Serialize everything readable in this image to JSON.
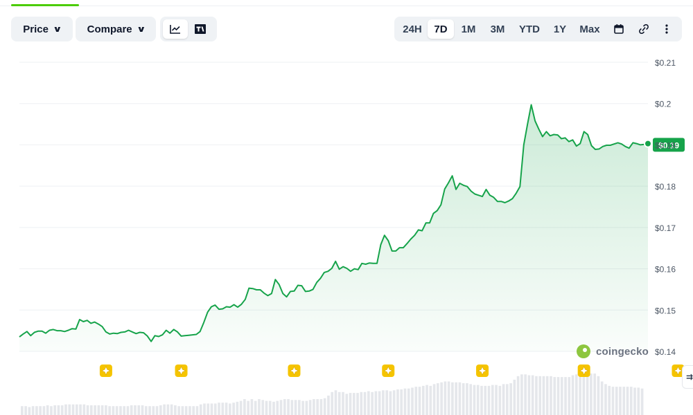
{
  "toolbar": {
    "price_label": "Price",
    "compare_label": "Compare",
    "line_chart_icon": "line-chart-icon",
    "tradingview_icon": "tradingview-icon",
    "ranges": [
      "24H",
      "7D",
      "1M",
      "3M",
      "YTD",
      "1Y",
      "Max"
    ],
    "active_range": "7D",
    "calendar_icon": "calendar-icon",
    "link_icon": "link-icon",
    "more_icon": "more-vertical-icon"
  },
  "watermark": {
    "text": "coingecko",
    "icon": "coingecko-logo-icon"
  },
  "side_tab": {
    "label": "⇉"
  },
  "colors": {
    "line": "#16a34a",
    "badge": "#16a34a",
    "marker": "#f5c400",
    "grid": "#eef0f3",
    "volume": "#e5e7eb"
  },
  "chart_data": {
    "type": "area",
    "title": "",
    "xlabel": "",
    "ylabel": "",
    "ylim": [
      0.14,
      0.21
    ],
    "y_ticks": [
      0.14,
      0.15,
      0.16,
      0.17,
      0.18,
      0.19,
      0.2,
      0.21
    ],
    "y_tick_labels": [
      "$0.14",
      "$0.15",
      "$0.16",
      "$0.17",
      "$0.18",
      "$0.19",
      "$0.2",
      "$0.21"
    ],
    "grid": true,
    "current_label": "$0.19",
    "current_value": 0.19,
    "series": [
      {
        "values": [
          0.1435,
          0.1442,
          0.1448,
          0.1438,
          0.1446,
          0.1449,
          0.1449,
          0.1444,
          0.1451,
          0.1453,
          0.145,
          0.145,
          0.1448,
          0.1451,
          0.1455,
          0.1454,
          0.1477,
          0.1472,
          0.1475,
          0.1468,
          0.1471,
          0.1466,
          0.146,
          0.1447,
          0.1442,
          0.1444,
          0.1443,
          0.1446,
          0.1447,
          0.1451,
          0.1447,
          0.1443,
          0.1446,
          0.1445,
          0.1437,
          0.1424,
          0.1438,
          0.1436,
          0.144,
          0.1451,
          0.1444,
          0.1453,
          0.1447,
          0.1437,
          0.1438,
          0.1439,
          0.144,
          0.1441,
          0.1448,
          0.147,
          0.1495,
          0.1508,
          0.1512,
          0.1502,
          0.1503,
          0.1508,
          0.1507,
          0.1513,
          0.1507,
          0.1514,
          0.1526,
          0.1553,
          0.1552,
          0.1549,
          0.1549,
          0.1541,
          0.1535,
          0.154,
          0.1574,
          0.1562,
          0.154,
          0.1532,
          0.1545,
          0.1546,
          0.156,
          0.1559,
          0.1545,
          0.1546,
          0.155,
          0.1567,
          0.1577,
          0.1591,
          0.1594,
          0.1601,
          0.1618,
          0.1599,
          0.1605,
          0.1601,
          0.1594,
          0.16,
          0.1598,
          0.1613,
          0.1611,
          0.1614,
          0.1613,
          0.1613,
          0.1658,
          0.1681,
          0.1668,
          0.1643,
          0.1643,
          0.1651,
          0.1651,
          0.1661,
          0.1672,
          0.1681,
          0.1694,
          0.1692,
          0.1711,
          0.1711,
          0.1734,
          0.1741,
          0.1755,
          0.1793,
          0.1808,
          0.1825,
          0.1792,
          0.1807,
          0.1802,
          0.1799,
          0.1788,
          0.1781,
          0.1778,
          0.1775,
          0.1792,
          0.1778,
          0.1773,
          0.1763,
          0.1763,
          0.176,
          0.1764,
          0.177,
          0.1783,
          0.1799,
          0.19,
          0.195,
          0.1997,
          0.1958,
          0.1938,
          0.192,
          0.1932,
          0.1922,
          0.1925,
          0.1924,
          0.1915,
          0.1917,
          0.1908,
          0.1912,
          0.1897,
          0.1903,
          0.1932,
          0.1925,
          0.1898,
          0.1889,
          0.189,
          0.1896,
          0.1899,
          0.1899,
          0.1902,
          0.1905,
          0.1902,
          0.1896,
          0.1892,
          0.1905,
          0.1903,
          0.19,
          0.1901,
          0.1903
        ]
      }
    ],
    "event_markers": [
      23,
      43,
      73,
      98,
      123,
      150,
      175
    ],
    "volume": [
      10,
      10,
      9,
      10,
      10,
      10,
      10,
      11,
      10,
      11,
      11,
      11,
      12,
      12,
      12,
      12,
      12,
      12,
      11,
      11,
      11,
      11,
      11,
      11,
      10,
      10,
      10,
      10,
      10,
      10,
      11,
      11,
      11,
      11,
      10,
      10,
      10,
      10,
      11,
      12,
      12,
      12,
      11,
      10,
      10,
      10,
      10,
      10,
      10,
      12,
      13,
      13,
      13,
      13,
      14,
      14,
      14,
      13,
      14,
      15,
      16,
      18,
      16,
      18,
      16,
      18,
      17,
      16,
      16,
      15,
      16,
      17,
      18,
      18,
      17,
      17,
      17,
      16,
      16,
      17,
      18,
      18,
      18,
      19,
      22,
      26,
      28,
      26,
      26,
      24,
      25,
      25,
      25,
      26,
      26,
      27,
      26,
      27,
      27,
      28,
      28,
      27,
      28,
      29,
      29,
      30,
      30,
      31,
      32,
      32,
      33,
      34,
      33,
      35,
      36,
      37,
      38,
      38,
      37,
      37,
      37,
      36,
      36,
      35,
      34,
      34,
      33,
      33,
      33,
      34,
      34,
      33,
      35,
      35,
      36,
      40,
      44,
      46,
      46,
      45,
      45,
      44,
      44,
      44,
      44,
      44,
      43,
      43,
      43,
      43,
      43,
      45,
      46,
      47,
      47,
      47,
      47,
      47,
      44,
      38,
      35,
      33,
      32,
      32,
      32,
      32,
      32,
      32,
      31,
      31,
      30
    ]
  }
}
